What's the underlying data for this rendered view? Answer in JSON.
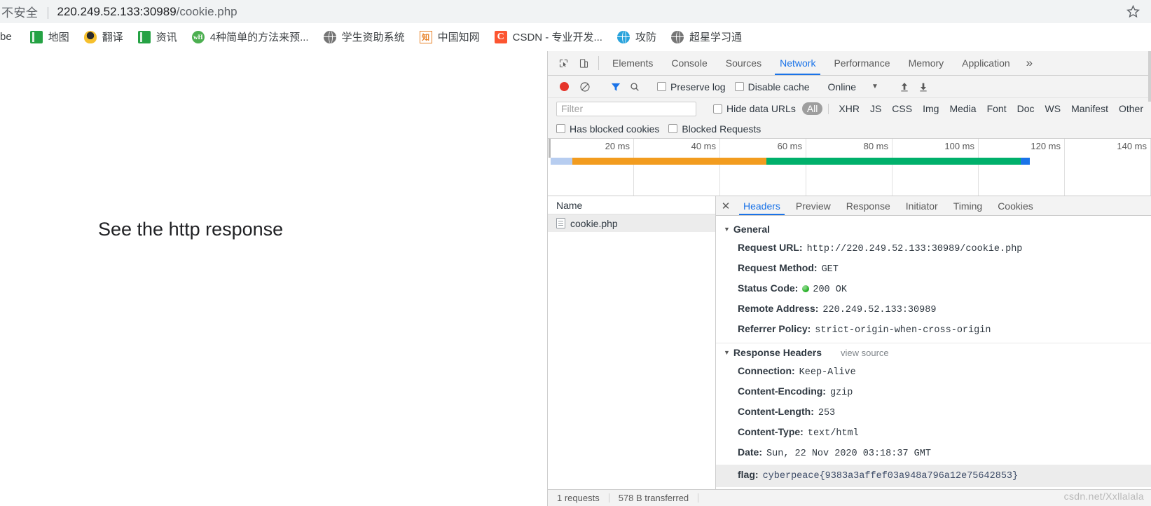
{
  "browser": {
    "security_label": "不安全",
    "url_scheme_host": "220.249.52.133:30989",
    "url_path": "/cookie.php",
    "url_full": "220.249.52.133:30989/cookie.php",
    "star_icon": "star-icon",
    "bookmarks": [
      {
        "label": "be",
        "icon": "partial-bookmark-icon"
      },
      {
        "label": "地图",
        "icon": "book-green-icon"
      },
      {
        "label": "翻译",
        "icon": "qq-penguin-icon"
      },
      {
        "label": "资讯",
        "icon": "book-green-icon"
      },
      {
        "label": "4种简单的方法来预...",
        "icon": "wikihow-icon"
      },
      {
        "label": "学生资助系统",
        "icon": "globe-gray-icon"
      },
      {
        "label": "中国知网",
        "icon": "cnki-zhi-icon"
      },
      {
        "label": "CSDN - 专业开发...",
        "icon": "csdn-icon"
      },
      {
        "label": "攻防",
        "icon": "globe-blue-icon"
      },
      {
        "label": "超星学习通",
        "icon": "globe-gray-icon"
      }
    ]
  },
  "page": {
    "heading": "See the http response"
  },
  "devtools": {
    "inspect_icon": "inspect-element-icon",
    "device_icon": "device-toolbar-icon",
    "tabs": [
      {
        "label": "Elements",
        "active": false
      },
      {
        "label": "Console",
        "active": false
      },
      {
        "label": "Sources",
        "active": false
      },
      {
        "label": "Network",
        "active": true
      },
      {
        "label": "Performance",
        "active": false
      },
      {
        "label": "Memory",
        "active": false
      },
      {
        "label": "Application",
        "active": false
      }
    ],
    "more_tabs_label": "»",
    "toolbar": {
      "record_icon": "record-stop-icon",
      "clear_icon": "clear-network-icon",
      "filter_icon": "filter-funnel-icon",
      "search_icon": "search-icon",
      "preserve_log_label": "Preserve log",
      "disable_cache_label": "Disable cache",
      "throttle_value": "Online",
      "throttle_caret": "▼",
      "import_icon": "import-har-icon",
      "export_icon": "export-har-icon"
    },
    "filterbar": {
      "filter_placeholder": "Filter",
      "hide_data_urls_label": "Hide data URLs",
      "types": [
        {
          "label": "All",
          "active": true
        },
        {
          "label": "XHR",
          "active": false
        },
        {
          "label": "JS",
          "active": false
        },
        {
          "label": "CSS",
          "active": false
        },
        {
          "label": "Img",
          "active": false
        },
        {
          "label": "Media",
          "active": false
        },
        {
          "label": "Font",
          "active": false
        },
        {
          "label": "Doc",
          "active": false
        },
        {
          "label": "WS",
          "active": false
        },
        {
          "label": "Manifest",
          "active": false
        },
        {
          "label": "Other",
          "active": false
        }
      ],
      "has_blocked_cookies_label": "Has blocked cookies",
      "blocked_requests_label": "Blocked Requests"
    },
    "overview": {
      "ticks": [
        "20 ms",
        "40 ms",
        "60 ms",
        "80 ms",
        "100 ms",
        "120 ms",
        "140 ms"
      ],
      "segments": [
        {
          "name": "queueing",
          "color": "#b7cdf0",
          "width_pct": 4.6
        },
        {
          "name": "stalled",
          "color": "#f29c1f",
          "width_pct": 40.5
        },
        {
          "name": "waiting",
          "color": "#00b06b",
          "width_pct": 53.0
        },
        {
          "name": "download",
          "color": "#1a73e8",
          "width_pct": 1.9
        }
      ]
    },
    "request_list": {
      "column_header": "Name",
      "rows": [
        {
          "name": "cookie.php",
          "icon": "document-icon",
          "selected": true
        }
      ]
    },
    "details": {
      "close_icon": "close-icon",
      "tabs": [
        {
          "label": "Headers",
          "active": true
        },
        {
          "label": "Preview",
          "active": false
        },
        {
          "label": "Response",
          "active": false
        },
        {
          "label": "Initiator",
          "active": false
        },
        {
          "label": "Timing",
          "active": false
        },
        {
          "label": "Cookies",
          "active": false
        }
      ],
      "general": {
        "section_label": "General",
        "triangle": "▼",
        "rows": [
          {
            "key": "Request URL:",
            "value": "http://220.249.52.133:30989/cookie.php"
          },
          {
            "key": "Request Method:",
            "value": "GET"
          },
          {
            "key": "Status Code:",
            "value": "200 OK",
            "status_dot": true
          },
          {
            "key": "Remote Address:",
            "value": "220.249.52.133:30989"
          },
          {
            "key": "Referrer Policy:",
            "value": "strict-origin-when-cross-origin"
          }
        ]
      },
      "response_headers": {
        "section_label": "Response Headers",
        "triangle": "▼",
        "view_source_label": "view source",
        "rows": [
          {
            "key": "Connection:",
            "value": "Keep-Alive"
          },
          {
            "key": "Content-Encoding:",
            "value": "gzip"
          },
          {
            "key": "Content-Length:",
            "value": "253"
          },
          {
            "key": "Content-Type:",
            "value": "text/html"
          },
          {
            "key": "Date:",
            "value": "Sun, 22 Nov 2020 03:18:37 GMT"
          },
          {
            "key": "flag:",
            "value": "cyberpeace{9383a3affef03a948a796a12e75642853}",
            "highlight": true
          }
        ]
      }
    },
    "status_bar": {
      "requests": "1 requests",
      "transferred": "578 B transferred"
    }
  },
  "watermark": "csdn.net/Xxllalala"
}
